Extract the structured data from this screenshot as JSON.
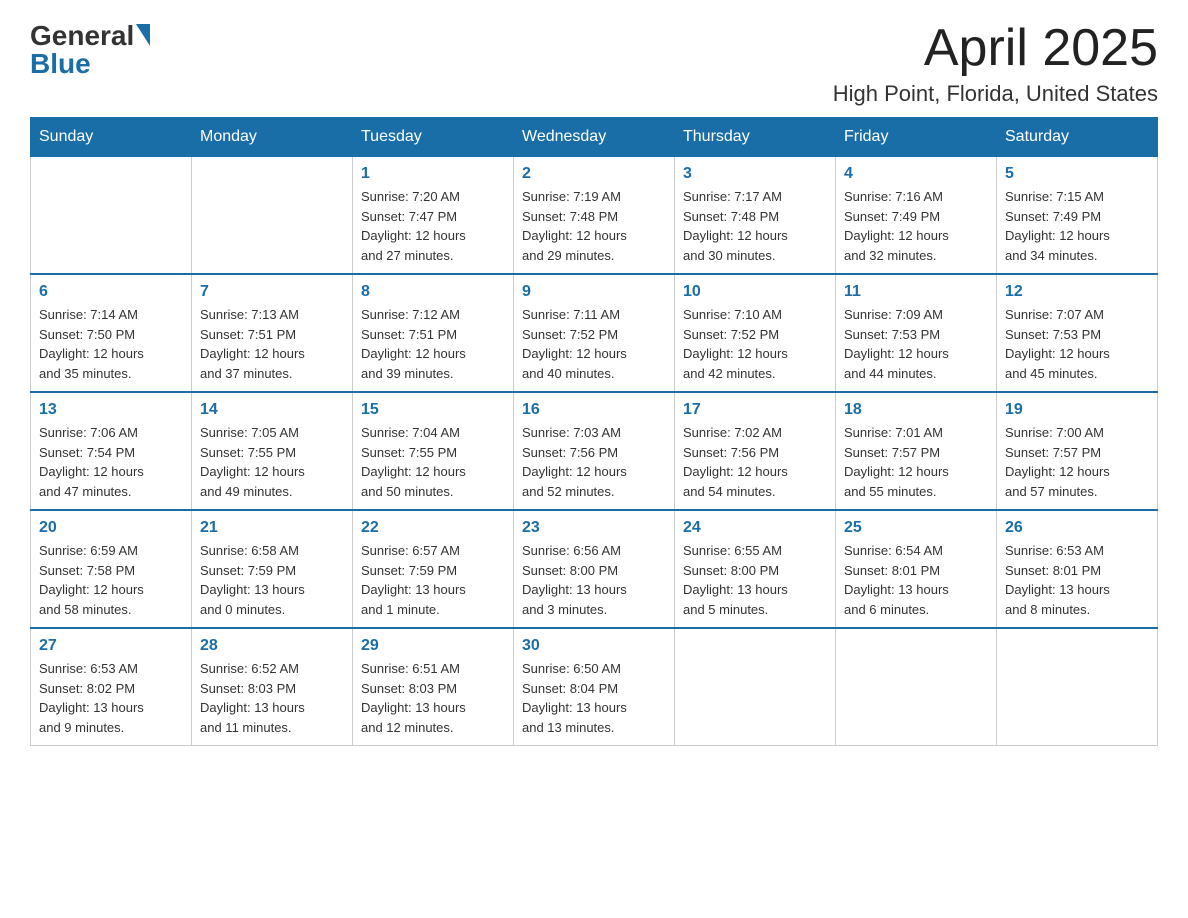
{
  "logo": {
    "general": "General",
    "blue": "Blue"
  },
  "title": "April 2025",
  "location": "High Point, Florida, United States",
  "weekdays": [
    "Sunday",
    "Monday",
    "Tuesday",
    "Wednesday",
    "Thursday",
    "Friday",
    "Saturday"
  ],
  "weeks": [
    [
      {
        "day": "",
        "info": ""
      },
      {
        "day": "",
        "info": ""
      },
      {
        "day": "1",
        "info": "Sunrise: 7:20 AM\nSunset: 7:47 PM\nDaylight: 12 hours\nand 27 minutes."
      },
      {
        "day": "2",
        "info": "Sunrise: 7:19 AM\nSunset: 7:48 PM\nDaylight: 12 hours\nand 29 minutes."
      },
      {
        "day": "3",
        "info": "Sunrise: 7:17 AM\nSunset: 7:48 PM\nDaylight: 12 hours\nand 30 minutes."
      },
      {
        "day": "4",
        "info": "Sunrise: 7:16 AM\nSunset: 7:49 PM\nDaylight: 12 hours\nand 32 minutes."
      },
      {
        "day": "5",
        "info": "Sunrise: 7:15 AM\nSunset: 7:49 PM\nDaylight: 12 hours\nand 34 minutes."
      }
    ],
    [
      {
        "day": "6",
        "info": "Sunrise: 7:14 AM\nSunset: 7:50 PM\nDaylight: 12 hours\nand 35 minutes."
      },
      {
        "day": "7",
        "info": "Sunrise: 7:13 AM\nSunset: 7:51 PM\nDaylight: 12 hours\nand 37 minutes."
      },
      {
        "day": "8",
        "info": "Sunrise: 7:12 AM\nSunset: 7:51 PM\nDaylight: 12 hours\nand 39 minutes."
      },
      {
        "day": "9",
        "info": "Sunrise: 7:11 AM\nSunset: 7:52 PM\nDaylight: 12 hours\nand 40 minutes."
      },
      {
        "day": "10",
        "info": "Sunrise: 7:10 AM\nSunset: 7:52 PM\nDaylight: 12 hours\nand 42 minutes."
      },
      {
        "day": "11",
        "info": "Sunrise: 7:09 AM\nSunset: 7:53 PM\nDaylight: 12 hours\nand 44 minutes."
      },
      {
        "day": "12",
        "info": "Sunrise: 7:07 AM\nSunset: 7:53 PM\nDaylight: 12 hours\nand 45 minutes."
      }
    ],
    [
      {
        "day": "13",
        "info": "Sunrise: 7:06 AM\nSunset: 7:54 PM\nDaylight: 12 hours\nand 47 minutes."
      },
      {
        "day": "14",
        "info": "Sunrise: 7:05 AM\nSunset: 7:55 PM\nDaylight: 12 hours\nand 49 minutes."
      },
      {
        "day": "15",
        "info": "Sunrise: 7:04 AM\nSunset: 7:55 PM\nDaylight: 12 hours\nand 50 minutes."
      },
      {
        "day": "16",
        "info": "Sunrise: 7:03 AM\nSunset: 7:56 PM\nDaylight: 12 hours\nand 52 minutes."
      },
      {
        "day": "17",
        "info": "Sunrise: 7:02 AM\nSunset: 7:56 PM\nDaylight: 12 hours\nand 54 minutes."
      },
      {
        "day": "18",
        "info": "Sunrise: 7:01 AM\nSunset: 7:57 PM\nDaylight: 12 hours\nand 55 minutes."
      },
      {
        "day": "19",
        "info": "Sunrise: 7:00 AM\nSunset: 7:57 PM\nDaylight: 12 hours\nand 57 minutes."
      }
    ],
    [
      {
        "day": "20",
        "info": "Sunrise: 6:59 AM\nSunset: 7:58 PM\nDaylight: 12 hours\nand 58 minutes."
      },
      {
        "day": "21",
        "info": "Sunrise: 6:58 AM\nSunset: 7:59 PM\nDaylight: 13 hours\nand 0 minutes."
      },
      {
        "day": "22",
        "info": "Sunrise: 6:57 AM\nSunset: 7:59 PM\nDaylight: 13 hours\nand 1 minute."
      },
      {
        "day": "23",
        "info": "Sunrise: 6:56 AM\nSunset: 8:00 PM\nDaylight: 13 hours\nand 3 minutes."
      },
      {
        "day": "24",
        "info": "Sunrise: 6:55 AM\nSunset: 8:00 PM\nDaylight: 13 hours\nand 5 minutes."
      },
      {
        "day": "25",
        "info": "Sunrise: 6:54 AM\nSunset: 8:01 PM\nDaylight: 13 hours\nand 6 minutes."
      },
      {
        "day": "26",
        "info": "Sunrise: 6:53 AM\nSunset: 8:01 PM\nDaylight: 13 hours\nand 8 minutes."
      }
    ],
    [
      {
        "day": "27",
        "info": "Sunrise: 6:53 AM\nSunset: 8:02 PM\nDaylight: 13 hours\nand 9 minutes."
      },
      {
        "day": "28",
        "info": "Sunrise: 6:52 AM\nSunset: 8:03 PM\nDaylight: 13 hours\nand 11 minutes."
      },
      {
        "day": "29",
        "info": "Sunrise: 6:51 AM\nSunset: 8:03 PM\nDaylight: 13 hours\nand 12 minutes."
      },
      {
        "day": "30",
        "info": "Sunrise: 6:50 AM\nSunset: 8:04 PM\nDaylight: 13 hours\nand 13 minutes."
      },
      {
        "day": "",
        "info": ""
      },
      {
        "day": "",
        "info": ""
      },
      {
        "day": "",
        "info": ""
      }
    ]
  ]
}
